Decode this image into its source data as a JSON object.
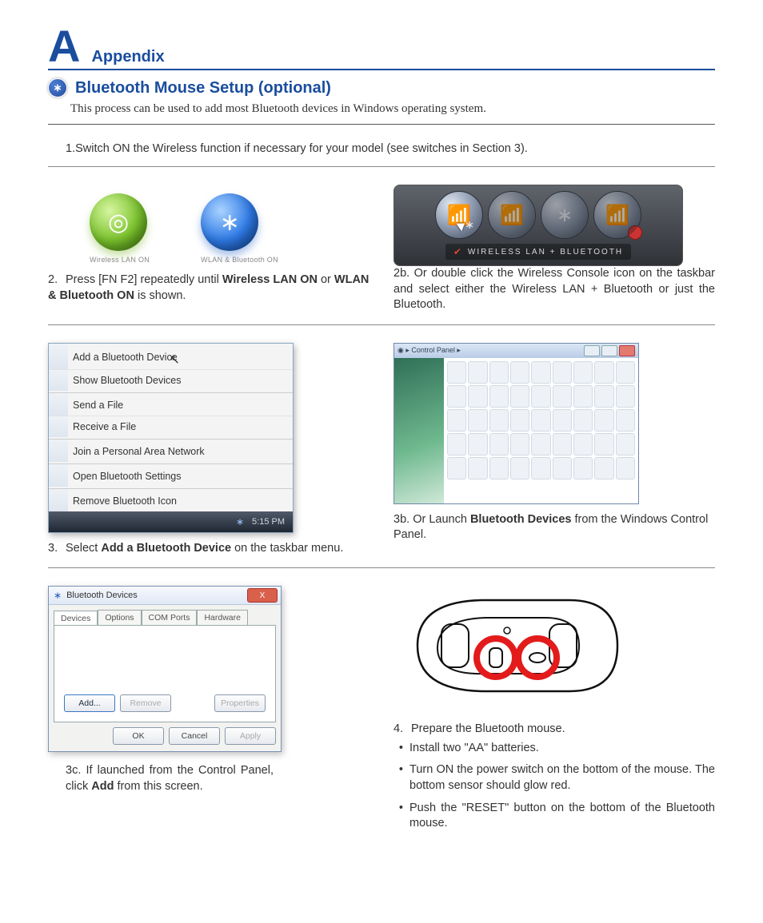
{
  "header": {
    "letter": "A",
    "word": "Appendix"
  },
  "title": "Bluetooth Mouse Setup (optional)",
  "intro": "This process can be used to add most Bluetooth devices in Windows operating system.",
  "step1": {
    "num": "1.",
    "text": "Switch ON the Wireless function if necessary for your model (see switches in Section 3)."
  },
  "row2": {
    "left_captions": {
      "a": "Wireless LAN ON",
      "b": "WLAN & Bluetooth ON"
    },
    "console_label": "WIRELESS LAN + BLUETOOTH",
    "step2": {
      "num": "2.",
      "pre": "Press [FN F2] repeatedly until ",
      "bold1": "Wireless LAN ON",
      "mid": " or ",
      "bold2": "WLAN & Bluetooth ON",
      "post": " is shown."
    },
    "step2b": {
      "num": "2b.",
      "text": "Or double click the Wireless Console icon on the taskbar and select either the Wireless LAN + Bluetooth or just the Bluetooth."
    }
  },
  "row3": {
    "menu": {
      "items": [
        "Add a Bluetooth Device",
        "Show Bluetooth Devices",
        "Send a File",
        "Receive a File",
        "Join a Personal Area Network",
        "Open Bluetooth Settings",
        "Remove Bluetooth Icon"
      ],
      "clock": "5:15 PM"
    },
    "cp_breadcrumb": "Control Panel",
    "step3": {
      "num": "3.",
      "pre": "Select ",
      "bold": "Add a Bluetooth Device",
      "post": " on the taskbar menu."
    },
    "step3b": {
      "num": "3b.",
      "pre": "Or Launch ",
      "bold": "Bluetooth Devices",
      "post": " from the Windows Control Panel."
    }
  },
  "row4": {
    "dlg": {
      "title": "Bluetooth Devices",
      "tabs": [
        "Devices",
        "Options",
        "COM Ports",
        "Hardware"
      ],
      "buttons": {
        "add": "Add...",
        "remove": "Remove",
        "properties": "Properties",
        "ok": "OK",
        "cancel": "Cancel",
        "apply": "Apply"
      }
    },
    "step3c": {
      "num": "3c.",
      "pre": "If launched from the Control Panel, click ",
      "bold": "Add",
      "post": " from this screen."
    },
    "step4": {
      "num": "4.",
      "text": "Prepare the Bluetooth mouse."
    },
    "bullets": [
      "Install two \"AA\" batteries.",
      "Turn ON the power switch on the bottom of the mouse. The bottom sensor should glow red.",
      "Push the \"RESET\" button on the bottom of the Bluetooth mouse."
    ]
  }
}
